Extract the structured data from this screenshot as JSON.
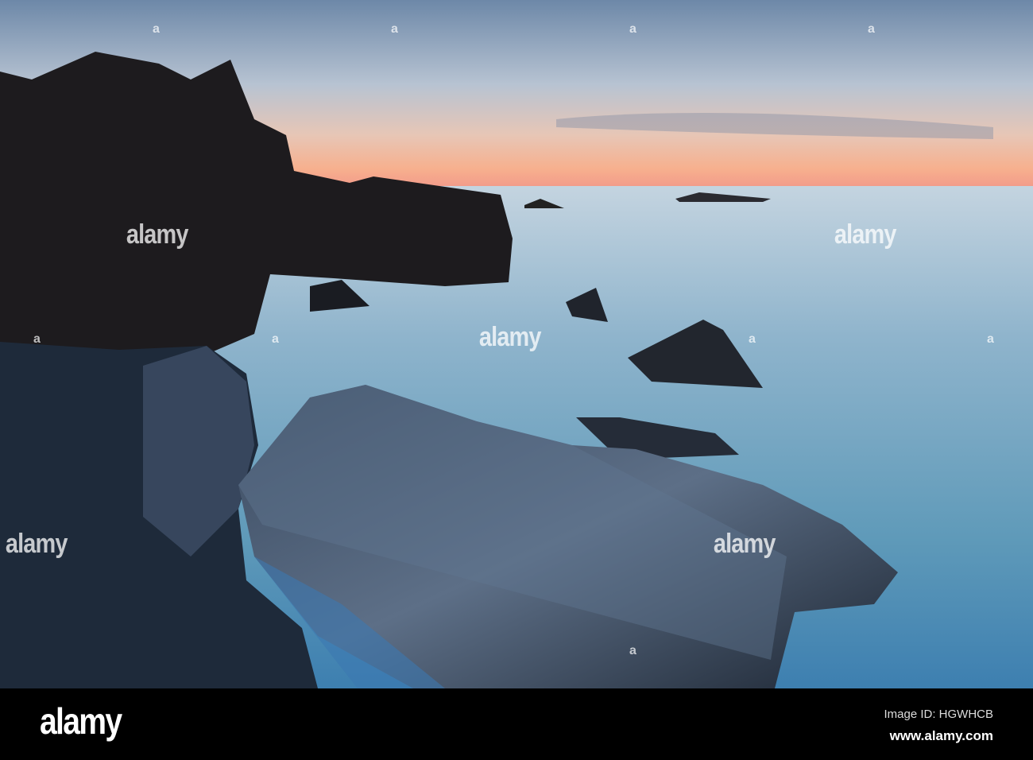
{
  "watermark": {
    "text": "alamy",
    "small": "a"
  },
  "footer": {
    "logo": "alamy",
    "image_id": "Image ID: HGWHCB",
    "url": "www.alamy.com"
  }
}
